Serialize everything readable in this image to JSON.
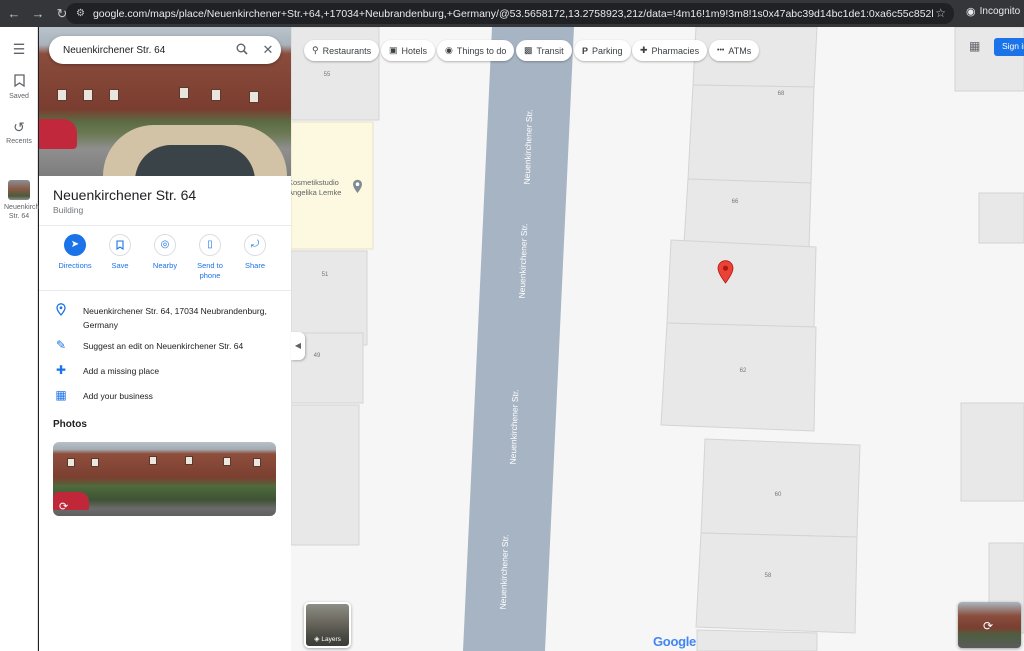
{
  "browser": {
    "url": "google.com/maps/place/Neuenkirchener+Str.+64,+17034+Neubrandenburg,+Germany/@53.5658172,13.2758923,21z/data=!4m16!1m9!3m8!1s0x47abc39d14bc1de1:0xa6c55c852b55b82e!2sNeuenkirche...",
    "mode_label": "Incognito",
    "icons": {
      "back": "back-arrow-icon",
      "forward": "forward-arrow-icon",
      "reload": "reload-icon",
      "star": "star-icon"
    }
  },
  "rail": {
    "menu_icon": "hamburger-menu-icon",
    "items": [
      {
        "label": "Saved",
        "icon": "bookmark-icon"
      },
      {
        "label": "Recents",
        "icon": "history-icon"
      },
      {
        "label": "Neuenkirch Str. 64",
        "icon": "place-thumbnail"
      }
    ]
  },
  "panel": {
    "search_value": "Neuenkirchener Str. 64",
    "place_title": "Neuenkirchener Str. 64",
    "place_type": "Building",
    "actions": [
      {
        "label": "Directions",
        "icon": "directions-icon"
      },
      {
        "label": "Save",
        "icon": "bookmark-icon"
      },
      {
        "label": "Nearby",
        "icon": "nearby-icon"
      },
      {
        "label": "Send to phone",
        "icon": "phone-icon"
      },
      {
        "label": "Share",
        "icon": "share-icon"
      }
    ],
    "info_rows": [
      {
        "text": "Neuenkirchener Str. 64, 17034 Neubrandenburg, Germany",
        "icon": "location-pin-icon"
      },
      {
        "text": "Suggest an edit on Neuenkirchener Str. 64",
        "icon": "pencil-icon"
      },
      {
        "text": "Add a missing place",
        "icon": "add-location-icon"
      },
      {
        "text": "Add your business",
        "icon": "storefront-icon"
      }
    ],
    "photos_heading": "Photos"
  },
  "map": {
    "chips": [
      {
        "label": "Restaurants",
        "icon": "fork-knife-icon"
      },
      {
        "label": "Hotels",
        "icon": "bed-icon"
      },
      {
        "label": "Things to do",
        "icon": "camera-icon"
      },
      {
        "label": "Transit",
        "icon": "bus-icon"
      },
      {
        "label": "Parking",
        "icon": "parking-icon"
      },
      {
        "label": "Pharmacies",
        "icon": "pharmacy-icon"
      },
      {
        "label": "ATMs",
        "icon": "atm-icon"
      }
    ],
    "signin_label": "Sign in",
    "street_name": "Neuenkirchener Str.",
    "poi_name": "Kosmetikstudio Angelika Lemke",
    "house_numbers": [
      "55",
      "51",
      "49",
      "68",
      "66",
      "62",
      "60",
      "58"
    ],
    "layers_label": "Layers",
    "logo_text": "Google",
    "colors": {
      "road": "#a7b4c4",
      "building": "#e8e8e8",
      "poi_area": "#fdf8e0",
      "pin": "#ea4335",
      "accent": "#1a73e8"
    }
  }
}
